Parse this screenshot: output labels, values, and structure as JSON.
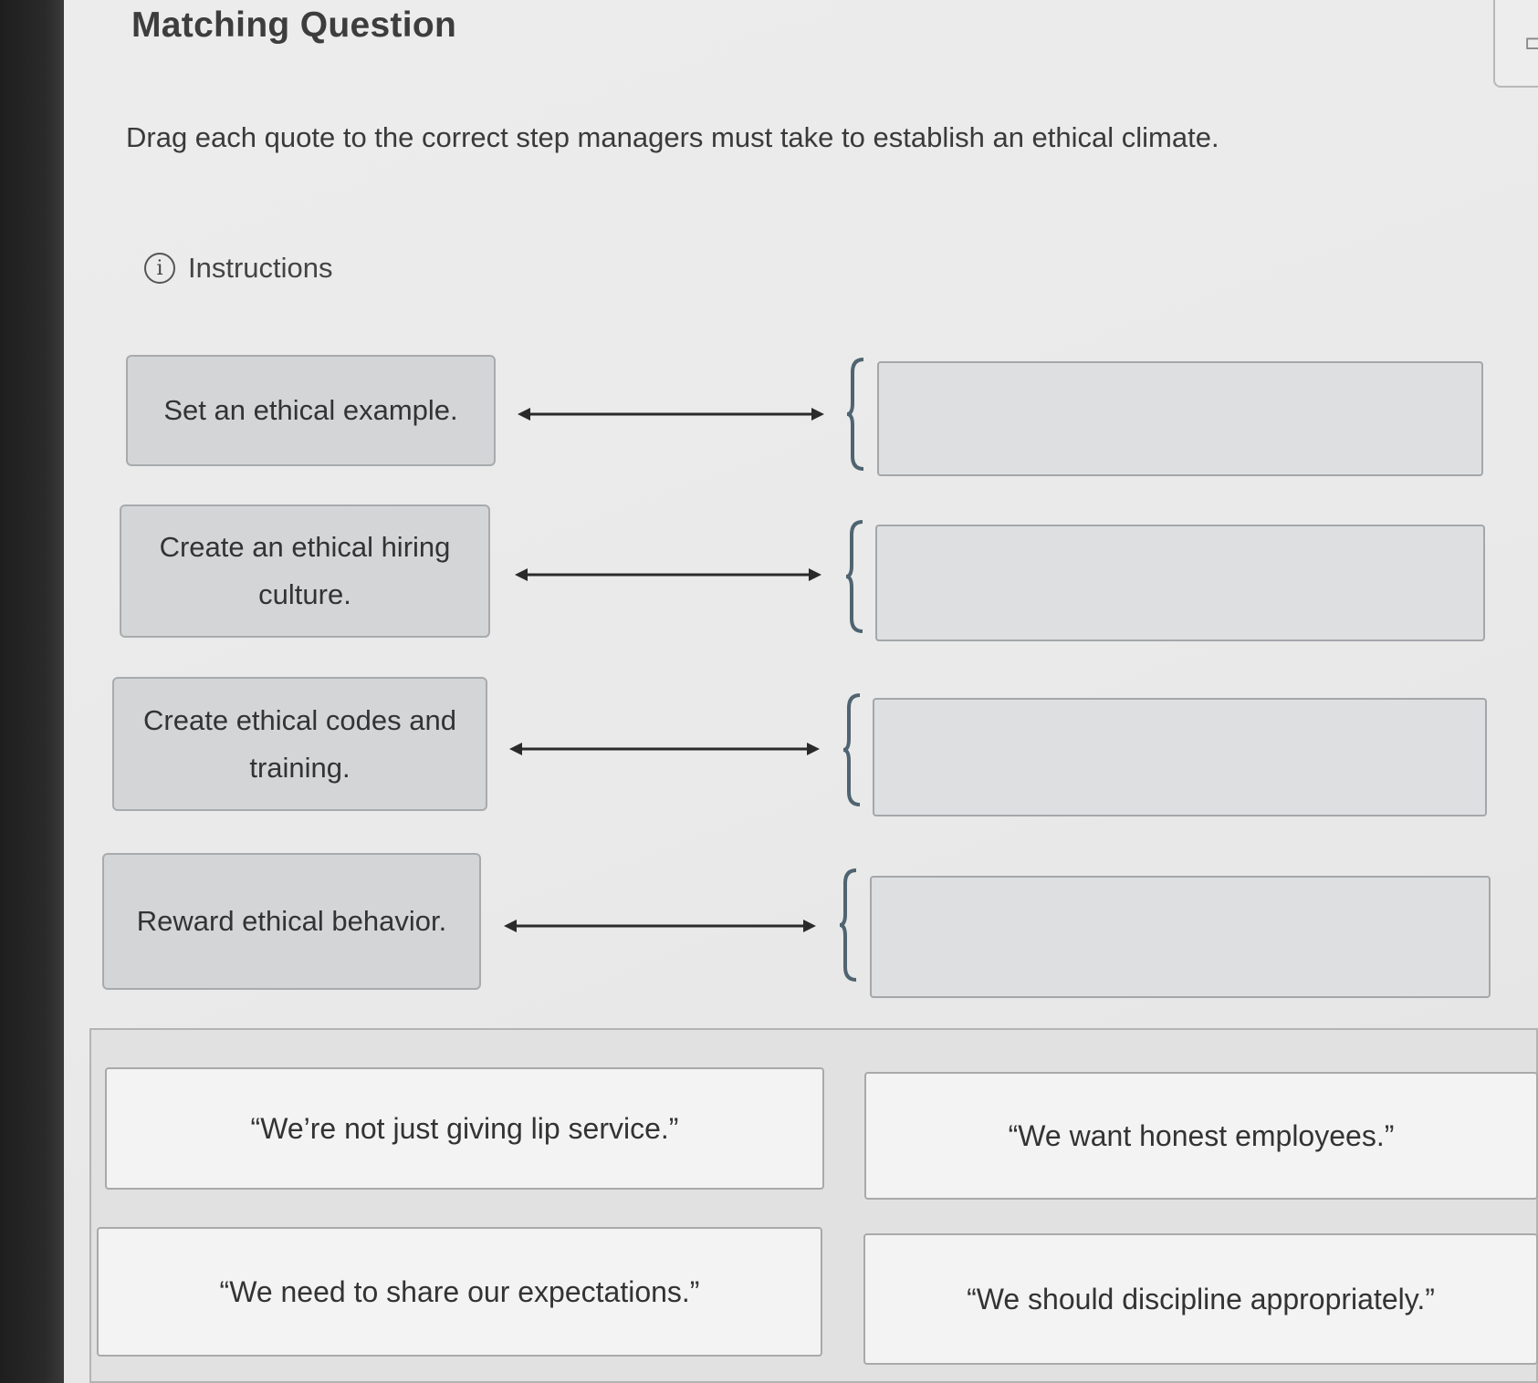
{
  "header": {
    "title": "Matching Question",
    "prompt": "Drag each quote to the correct step managers must take to establish an ethical climate.",
    "instructions_label": "Instructions",
    "info_icon": "i"
  },
  "prompts": [
    {
      "label": "Set an ethical example."
    },
    {
      "label": "Create an ethical hiring culture."
    },
    {
      "label": "Create ethical codes and training."
    },
    {
      "label": "Reward ethical behavior."
    }
  ],
  "drop_targets": [
    {
      "value": ""
    },
    {
      "value": ""
    },
    {
      "value": ""
    },
    {
      "value": ""
    }
  ],
  "answer_bank": [
    {
      "text": "“We’re not just giving lip service.”"
    },
    {
      "text": "“We want honest employees.”"
    },
    {
      "text": "“We need to share our expectations.”"
    },
    {
      "text": "“We should discipline appropriately.”"
    }
  ],
  "colors": {
    "prompt_fill": "#d3d5d6",
    "drop_fill": "#dedfe0",
    "brace": "#4f6470",
    "arrow": "#2a2a2a"
  }
}
